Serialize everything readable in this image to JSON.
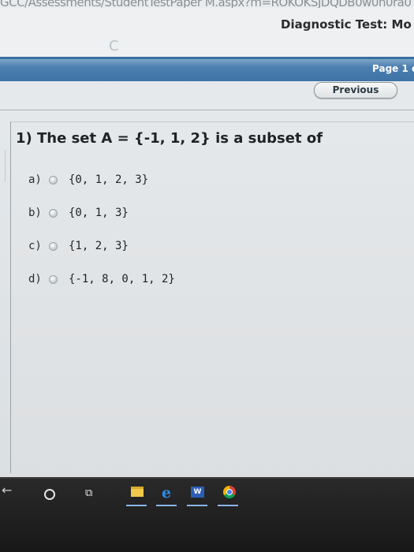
{
  "browser": {
    "url_fragment": "GCC/Assessments/StudentTestPaper M.aspx?m=ROKOKSJDQDB0w0n0ra0"
  },
  "header": {
    "title": "Diagnostic Test: Mo",
    "page_indicator": "Page 1 c",
    "previous_label": "Previous"
  },
  "question": {
    "number_and_text": "1) The set A = {-1, 1, 2} is a subset of",
    "options": [
      {
        "letter": "a)",
        "text": "{0, 1, 2, 3}"
      },
      {
        "letter": "b)",
        "text": "{0, 1, 3}"
      },
      {
        "letter": "c)",
        "text": "{1, 2, 3}"
      },
      {
        "letter": "d)",
        "text": "{-1, 8, 0, 1, 2}"
      }
    ]
  },
  "taskbar": {
    "word_label": "W",
    "icons": [
      "back-arrow-icon",
      "cortana-icon",
      "task-view-icon",
      "file-explorer-icon",
      "edge-icon",
      "word-icon",
      "chrome-icon"
    ]
  },
  "colors": {
    "blue_bar": "#3f73a6",
    "taskbar": "#1c1c1c"
  }
}
